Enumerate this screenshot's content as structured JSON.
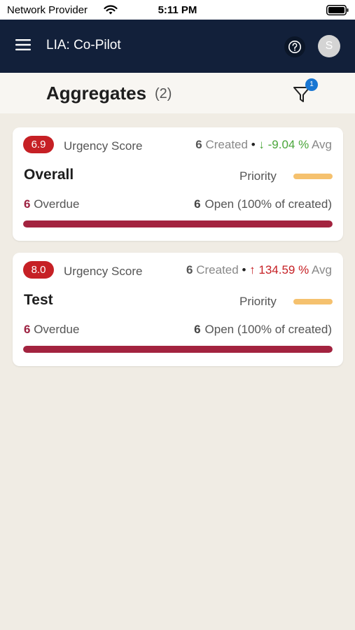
{
  "status_bar": {
    "carrier": "Network Provider",
    "time": "5:11 PM"
  },
  "header": {
    "title": "LIA: Co-Pilot",
    "avatar_initial": "S",
    "background_color": "#12203a"
  },
  "aggregates": {
    "title": "Aggregates",
    "count_text": "(2)",
    "filter_badge": "1"
  },
  "cards": [
    {
      "score": "6.9",
      "urgency_label": "Urgency Score",
      "created_count": "6",
      "created_label": "Created",
      "separator": "•",
      "trend_arrow": "↓",
      "trend_direction": "down",
      "trend_text": "-9.04 %",
      "avg_label": "Avg",
      "name": "Overall",
      "priority_label": "Priority",
      "overdue_count": "6",
      "overdue_label": "Overdue",
      "open_count": "6",
      "open_label": "Open (100% of created)",
      "progress_fraction": 1.0
    },
    {
      "score": "8.0",
      "urgency_label": "Urgency Score",
      "created_count": "6",
      "created_label": "Created",
      "separator": "•",
      "trend_arrow": "↑",
      "trend_direction": "up",
      "trend_text": "134.59 %",
      "avg_label": "Avg",
      "name": "Test",
      "priority_label": "Priority",
      "overdue_count": "6",
      "overdue_label": "Overdue",
      "open_count": "6",
      "open_label": "Open (100% of created)",
      "progress_fraction": 1.0
    }
  ],
  "colors": {
    "score_badge": "#c62025",
    "trend_down": "#4aa63a",
    "trend_up": "#c62025",
    "priority_bar": "#f5c16e",
    "progress": "#a3233f",
    "filter_badge": "#1976d2"
  },
  "icons": {
    "menu": "hamburger-menu-icon",
    "help": "question-circle-icon",
    "filter": "funnel-icon",
    "wifi": "wifi-icon",
    "battery": "battery-icon"
  }
}
